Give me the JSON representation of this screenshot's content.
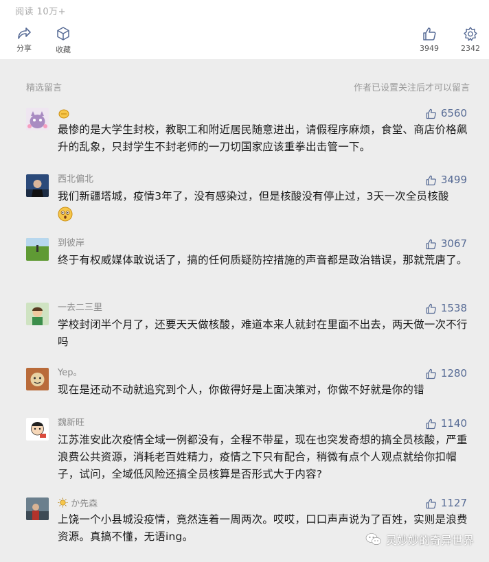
{
  "header": {
    "read_count": "阅读 10万+"
  },
  "actions": {
    "share_label": "分享",
    "favorite_label": "收藏",
    "like_count": "3949",
    "wow_count": "2342"
  },
  "section": {
    "title": "精选留言",
    "note": "作者已设置关注后才可以留言"
  },
  "comments": [
    {
      "nick": "",
      "likes": "6560",
      "text": "最惨的是大学生封校，教职工和附近居民随意进出，请假程序麻烦，食堂、商店价格飙升的乱象，只封学生不封老师的一刀切国家应该重拳出击管一下。"
    },
    {
      "nick": "西北偏北",
      "likes": "3499",
      "text": "我们新疆塔城，疫情3年了，没有感染过，但是核酸没有停止过，3天一次全员核酸"
    },
    {
      "nick": "到彼岸",
      "likes": "3067",
      "text": "终于有权威媒体敢说话了，搞的任何质疑防控措施的声音都是政治错误，那就荒唐了。"
    },
    {
      "nick": "一去二三里",
      "likes": "1538",
      "text": "学校封闭半个月了，还要天天做核酸，难道本来人就封在里面不出去，两天做一次不行吗"
    },
    {
      "nick": "Yep。",
      "likes": "1280",
      "text": "现在是还动不动就追究到个人，你做得好是上面决策对，你做不好就是你的错"
    },
    {
      "nick": "魏新旺",
      "likes": "1140",
      "text": "江苏淮安此次疫情全域一例都没有，全程不带星，现在也突发奇想的搞全员核酸，严重浪费公共资源，消耗老百姓精力，疫情之下只有配合，稍微有点个人观点就给你扣帽子，试问，全域低风险还搞全员核算是否形式大于内容?"
    },
    {
      "nick": "か先森",
      "likes": "1127",
      "text": "上饶一个小县城没疫情，竟然连着一周两次。哎哎，口口声声说为了百姓，实则是浪费资源。真搞不懂，无语ing。"
    }
  ],
  "watermark": "灵妙妙的奇异世界",
  "colors": {
    "link": "#576b95",
    "background": "#ededed"
  }
}
